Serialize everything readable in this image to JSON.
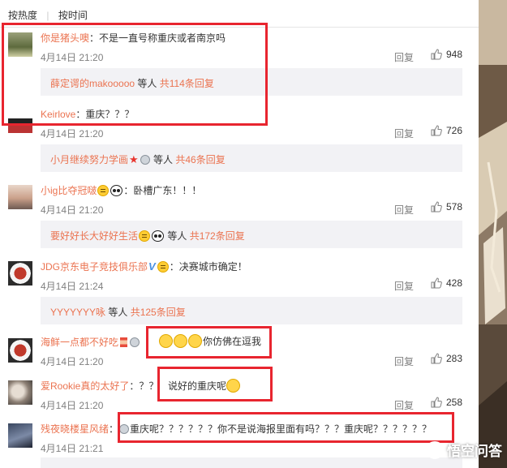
{
  "sort_tabs": {
    "hot": "按热度",
    "time": "按时间",
    "separator": "|"
  },
  "comments": [
    {
      "user": "你是猪头噢",
      "sep": "：",
      "text": "不是一直号称重庆或者南京吗",
      "time": "4月14日 21:20",
      "reply": "回复",
      "likes": "948",
      "sub": {
        "users": "薛定谔的makooooo",
        "etc": " 等人 ",
        "total": "共114条回复"
      }
    },
    {
      "user": "Keirlove",
      "sep": "：",
      "text": "重庆？？？",
      "time": "4月14日 21:20",
      "reply": "回复",
      "likes": "726",
      "sub": {
        "users": "小月继续努力学画",
        "etc": " 等人 ",
        "total": "共46条回复"
      }
    },
    {
      "user": "小ig比夺冠啵",
      "sep": "：",
      "text": "卧槽广东！！！",
      "time": "4月14日 21:20",
      "reply": "回复",
      "likes": "578",
      "sub": {
        "users": "要好好长大好好生活",
        "etc": " 等人 ",
        "total": "共172条回复"
      }
    },
    {
      "user": "JDG京东电子竞技俱乐部",
      "sep": "：",
      "text": "决赛城市确定！",
      "time": "4月14日 21:24",
      "reply": "回复",
      "likes": "428",
      "sub": {
        "users": "YYYYYYY咏",
        "etc": " 等人 ",
        "total": "共125条回复"
      }
    },
    {
      "user": "海鲜一点都不好吃",
      "sep": "：",
      "text": "你仿佛在逗我",
      "time": "4月14日 21:20",
      "reply": "回复",
      "likes": "283"
    },
    {
      "user": "爱Rookie真的太好了",
      "sep": "：",
      "text": "说好的重庆呢",
      "pre": "？？",
      "time": "4月14日 21:20",
      "reply": "回复",
      "likes": "258"
    },
    {
      "user": "残夜晓楼星风绪",
      "sep": "：",
      "text": "重庆呢？？？？？？你不是说海报里面有吗？？？重庆呢？？？？？？",
      "time": "4月14日 21:21",
      "reply": "回复",
      "likes": ""
    }
  ],
  "watermark": {
    "text": "悟空问答"
  },
  "colors": {
    "username": "#eb7350",
    "annotation_red": "#e8252f",
    "sub_reply_bg": "#f2f2f5"
  },
  "icons": [
    "thumb-up-icon",
    "crown-badge-icon",
    "panda-emoji-icon",
    "medal-icon",
    "verified-v-icon",
    "hourglass-icon",
    "star-icon",
    "smiley-emoji-icon"
  ]
}
